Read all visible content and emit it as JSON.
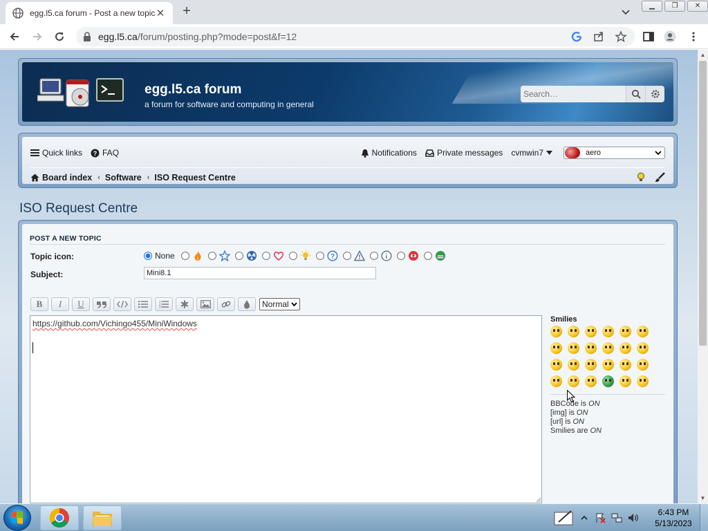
{
  "browser": {
    "tab_title": "egg.l5.ca forum - Post a new topic",
    "url_host": "egg.l5.ca",
    "url_path": "/forum/posting.php?mode=post&f=12"
  },
  "site": {
    "title": "egg.l5.ca forum",
    "description": "a forum for software and computing in general",
    "search_placeholder": "Search…"
  },
  "nav": {
    "quick_links": "Quick links",
    "faq": "FAQ",
    "notifications": "Notifications",
    "private_messages": "Private messages",
    "username": "cvmwin7",
    "style_value": "aero",
    "breadcrumb": [
      "Board index",
      "Software",
      "ISO Request Centre"
    ]
  },
  "forum_title": "ISO Request Centre",
  "post": {
    "heading": "POST A NEW TOPIC",
    "topic_icon_label": "Topic icon:",
    "none_label": "None",
    "topic_icons": [
      "fire-icon",
      "star-icon",
      "radioactive-icon",
      "heart-icon",
      "lightbulb-icon",
      "question-icon",
      "warning-icon",
      "info-icon",
      "red-face-icon",
      "green-face-icon"
    ],
    "selected_topic_icon": "None",
    "subject_label": "Subject:",
    "subject_value": "Mini8.1",
    "font_size_value": "Normal",
    "message_text": "https://github.com/Vichingo455/MiniWindows",
    "smilies_title": "Smilies",
    "status": {
      "bbcode_prefix": "BBCode is ",
      "bbcode_state": "ON",
      "img_prefix": "[img] is ",
      "img_state": "ON",
      "url_prefix": "[url] is ",
      "url_state": "ON",
      "smilies_prefix": "Smilies are ",
      "smilies_state": "ON"
    }
  },
  "taskbar": {
    "time": "6:43 PM",
    "date": "5/13/2023"
  },
  "colors": {
    "header_dark": "#0c3a6a",
    "accent_blue": "#1a73e8",
    "smiley_yellow": "#f6c21c",
    "smiley_green": "#2e9b4a"
  }
}
